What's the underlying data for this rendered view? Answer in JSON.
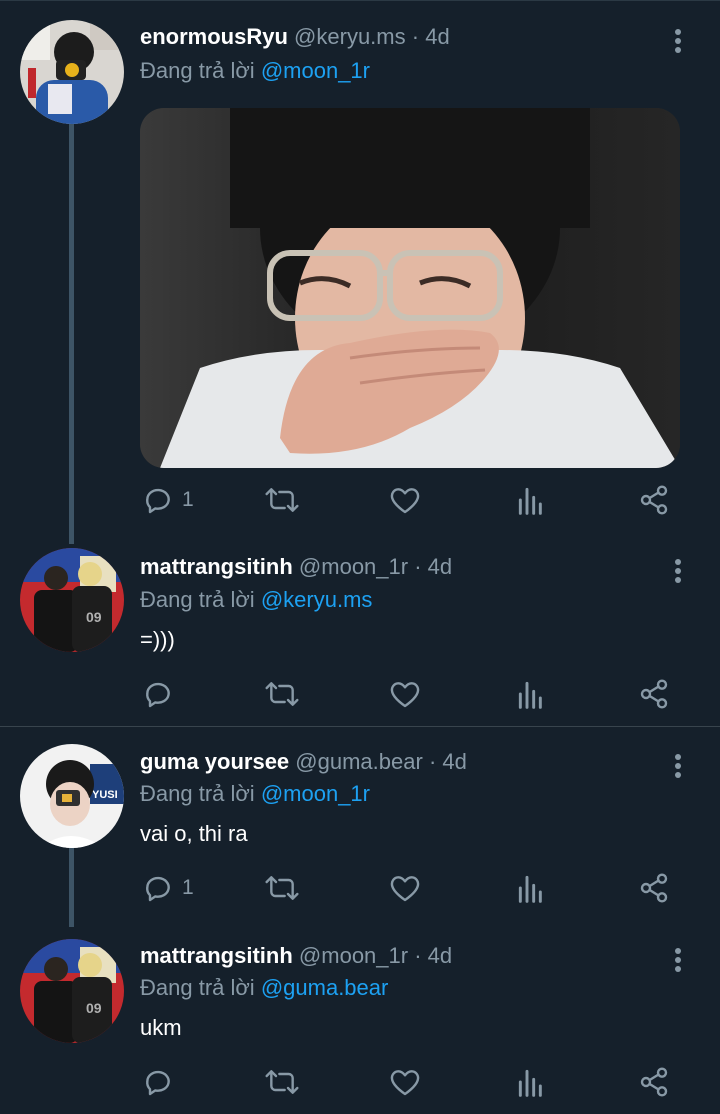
{
  "replying_prefix": "Đang trả lời",
  "tweets": [
    {
      "display_name": "enormousRyu",
      "handle": "@keryu.ms",
      "separator": "·",
      "time": "4d",
      "reply_to": "@moon_1r",
      "text": "",
      "has_media": true,
      "reply_count": "1",
      "avatar_icon": "avatar-photo-camera"
    },
    {
      "display_name": "mattrangsitinh",
      "handle": "@moon_1r",
      "separator": "·",
      "time": "4d",
      "reply_to": "@keryu.ms",
      "text": "=)))",
      "has_media": false,
      "reply_count": "",
      "avatar_icon": "avatar-jersey-09"
    },
    {
      "display_name": "guma yoursee",
      "handle": "@guma.bear",
      "separator": "·",
      "time": "4d",
      "reply_to": "@moon_1r",
      "text": "vai o, thi ra",
      "has_media": false,
      "reply_count": "1",
      "avatar_icon": "avatar-photo-camera"
    },
    {
      "display_name": "mattrangsitinh",
      "handle": "@moon_1r",
      "separator": "·",
      "time": "4d",
      "reply_to": "@guma.bear",
      "text": "ukm",
      "has_media": false,
      "reply_count": "",
      "avatar_icon": "avatar-jersey-09"
    }
  ],
  "icons": [
    "reply-icon",
    "retweet-icon",
    "like-icon",
    "analytics-icon",
    "share-icon",
    "more-options-icon"
  ],
  "colors": {
    "background": "#15202b",
    "secondary_text": "#8899a6",
    "mention": "#1da1f2",
    "thread_line": "#3d5466",
    "divider": "#38444d"
  }
}
